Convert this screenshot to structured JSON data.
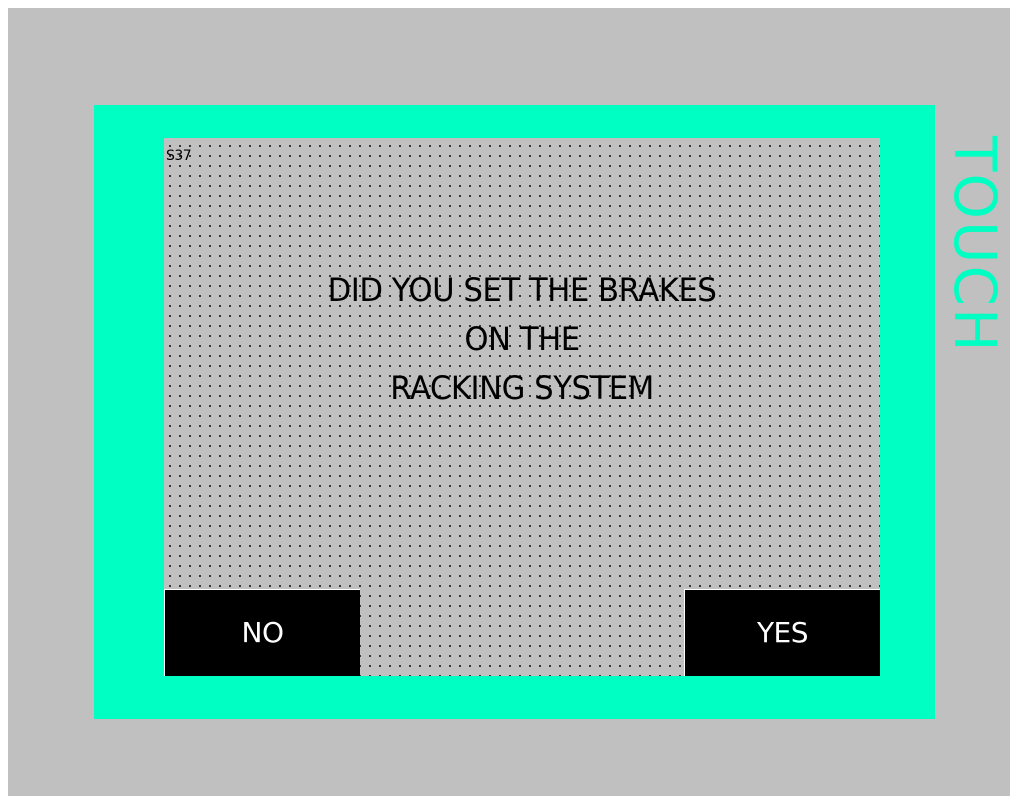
{
  "screen": {
    "id": "S37",
    "message_lines": [
      "DID YOU SET THE BRAKES",
      "ON THE",
      "RACKING SYSTEM"
    ]
  },
  "buttons": {
    "no_label": "NO",
    "yes_label": "YES"
  },
  "bezel": {
    "label": "TOUCH"
  },
  "colors": {
    "bezel": "#00ffc2",
    "background": "#c0c0c0",
    "button_fill": "#000000",
    "button_text": "#ffffff"
  }
}
